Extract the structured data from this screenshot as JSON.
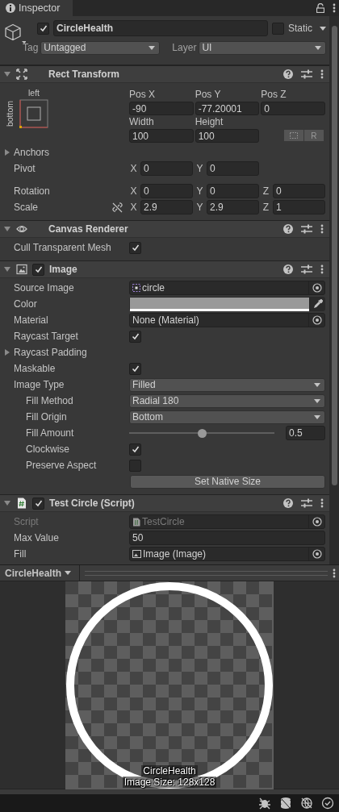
{
  "tab": {
    "title": "Inspector"
  },
  "game_object": {
    "active": true,
    "name": "CircleHealth",
    "static": false,
    "static_label": "Static",
    "tag_label": "Tag",
    "tag": "Untagged",
    "layer_label": "Layer",
    "layer": "UI"
  },
  "components": [
    {
      "kind": "rect_transform",
      "title": "Rect Transform",
      "expanded": true,
      "anchor_labels": {
        "horizontal": "left",
        "vertical": "bottom"
      },
      "position": [
        {
          "label": "Pos X",
          "value": "-90"
        },
        {
          "label": "Pos Y",
          "value": "-77.20001"
        },
        {
          "label": "Pos Z",
          "value": "0"
        }
      ],
      "size": [
        {
          "label": "Width",
          "value": "100"
        },
        {
          "label": "Height",
          "value": "100"
        }
      ],
      "raw_button": "R",
      "rows": [
        {
          "kind": "foldout",
          "label": "Anchors",
          "expanded": false
        },
        {
          "kind": "vector",
          "label": "Pivot",
          "axes": [
            {
              "axis": "X",
              "value": "0"
            },
            {
              "axis": "Y",
              "value": "0"
            }
          ]
        },
        {
          "kind": "vector",
          "label": "Rotation",
          "axes": [
            {
              "axis": "X",
              "value": "0"
            },
            {
              "axis": "Y",
              "value": "0"
            },
            {
              "axis": "Z",
              "value": "0"
            }
          ]
        },
        {
          "kind": "vector",
          "label": "Scale",
          "constrained": false,
          "axes": [
            {
              "axis": "X",
              "value": "2.9"
            },
            {
              "axis": "Y",
              "value": "2.9"
            },
            {
              "axis": "Z",
              "value": "1"
            }
          ]
        }
      ]
    },
    {
      "kind": "canvas_renderer",
      "title": "Canvas Renderer",
      "expanded": true,
      "rows": [
        {
          "kind": "checkbox",
          "label": "Cull Transparent Mesh",
          "checked": true
        }
      ]
    },
    {
      "kind": "image",
      "title": "Image",
      "expanded": true,
      "enabled": true,
      "rows": [
        {
          "kind": "sprite",
          "label": "Source Image",
          "value": "circle"
        },
        {
          "kind": "color",
          "label": "Color",
          "color": "#999999"
        },
        {
          "kind": "object",
          "label": "Material",
          "value": "None (Material)"
        },
        {
          "kind": "checkbox",
          "label": "Raycast Target",
          "checked": true
        },
        {
          "kind": "foldout",
          "label": "Raycast Padding",
          "expanded": false
        },
        {
          "kind": "checkbox",
          "label": "Maskable",
          "checked": true
        },
        {
          "kind": "dropdown",
          "label": "Image Type",
          "value": "Filled",
          "children": [
            {
              "kind": "dropdown",
              "label": "Fill Method",
              "value": "Radial 180"
            },
            {
              "kind": "dropdown",
              "label": "Fill Origin",
              "value": "Bottom"
            },
            {
              "kind": "slider",
              "label": "Fill Amount",
              "level": 0.5,
              "value": "0.5"
            },
            {
              "kind": "checkbox",
              "label": "Clockwise",
              "checked": true
            },
            {
              "kind": "checkbox",
              "label": "Preserve Aspect",
              "checked": false
            }
          ]
        },
        {
          "kind": "button",
          "label": "Set Native Size"
        }
      ]
    },
    {
      "kind": "script",
      "title": "Test Circle (Script)",
      "expanded": true,
      "enabled": true,
      "rows": [
        {
          "kind": "script",
          "label": "Script",
          "value": "TestCircle",
          "disabled": true
        },
        {
          "kind": "field",
          "label": "Max Value",
          "value": "50"
        },
        {
          "kind": "component",
          "label": "Fill",
          "value": "Image (Image)"
        }
      ]
    }
  ],
  "preview": {
    "title": "CircleHealth",
    "caption": "CircleHealth",
    "size_text": "Image Size: 128x128"
  }
}
